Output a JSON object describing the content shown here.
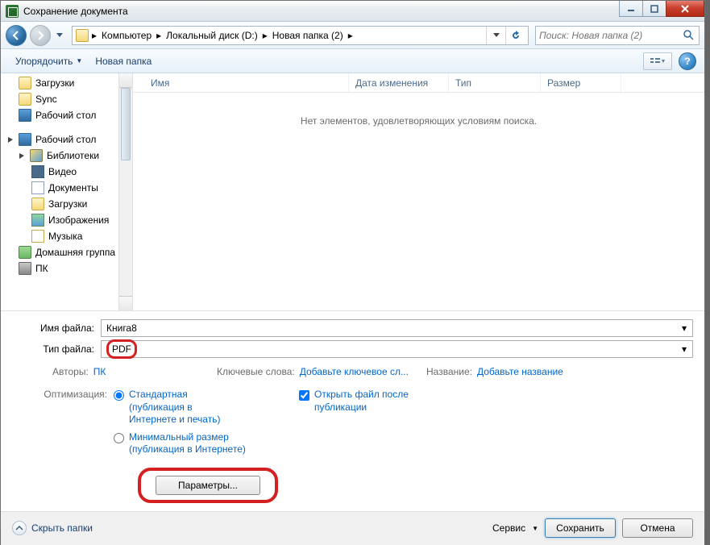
{
  "window": {
    "title": "Сохранение документа"
  },
  "breadcrumb": {
    "parts": [
      "Компьютер",
      "Локальный диск (D:)",
      "Новая папка (2)"
    ]
  },
  "search": {
    "placeholder": "Поиск: Новая папка (2)"
  },
  "toolbar": {
    "organize": "Упорядочить",
    "newfolder": "Новая папка"
  },
  "sidebar": {
    "items": [
      "Загрузки",
      "Sync",
      "Рабочий стол",
      "Рабочий стол",
      "Библиотеки",
      "Видео",
      "Документы",
      "Загрузки",
      "Изображения",
      "Музыка",
      "Домашняя группа",
      "ПК"
    ]
  },
  "columns": {
    "name": "Имя",
    "date": "Дата изменения",
    "type": "Тип",
    "size": "Размер"
  },
  "content": {
    "empty": "Нет элементов, удовлетворяющих условиям поиска."
  },
  "form": {
    "filename_label": "Имя файла:",
    "filename_value": "Книга8",
    "filetype_label": "Тип файла:",
    "filetype_value": "PDF"
  },
  "meta": {
    "authors_label": "Авторы:",
    "authors_value": "ПК",
    "keywords_label": "Ключевые слова:",
    "keywords_link": "Добавьте ключевое сл...",
    "title_label": "Название:",
    "title_link": "Добавьте название"
  },
  "optimize": {
    "label": "Оптимизация:",
    "standard": "Стандартная (публикация в Интернете и печать)",
    "minimal": "Минимальный размер (публикация в Интернете)",
    "open_after": "Открыть файл после публикации",
    "params_btn": "Параметры..."
  },
  "footer": {
    "hide": "Скрыть папки",
    "service": "Сервис",
    "save": "Сохранить",
    "cancel": "Отмена"
  }
}
